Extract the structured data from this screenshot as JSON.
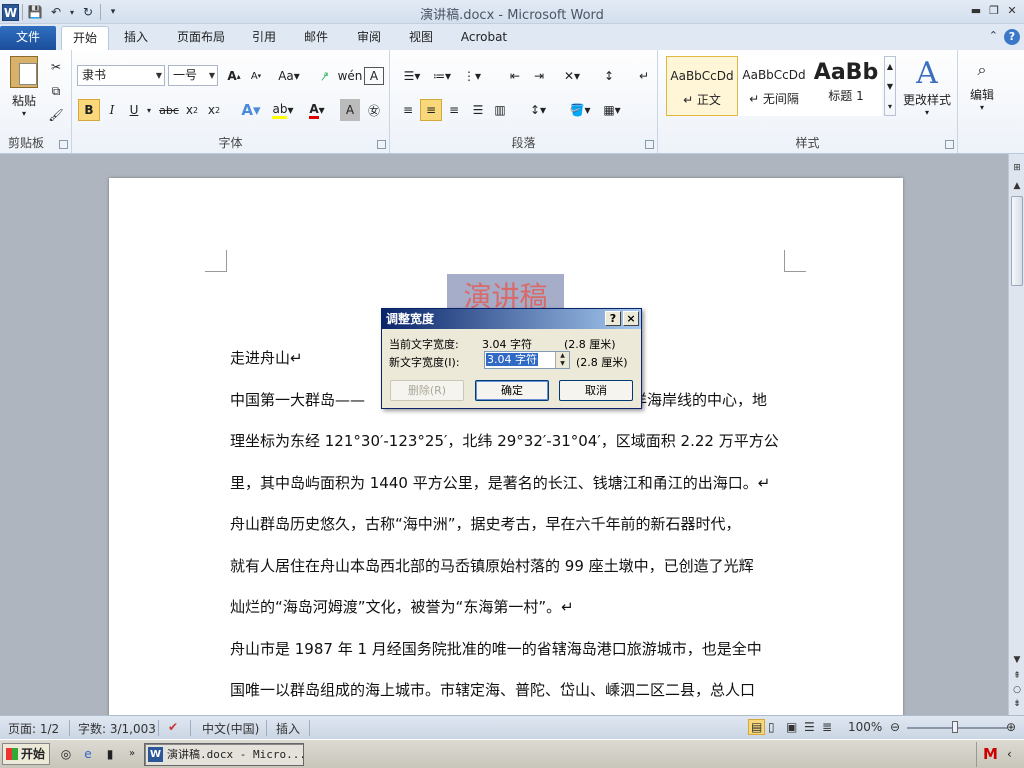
{
  "window": {
    "title": "演讲稿.docx - Microsoft Word"
  },
  "tabs": [
    {
      "label": "文件"
    },
    {
      "label": "开始"
    },
    {
      "label": "插入"
    },
    {
      "label": "页面布局"
    },
    {
      "label": "引用"
    },
    {
      "label": "邮件"
    },
    {
      "label": "审阅"
    },
    {
      "label": "视图"
    },
    {
      "label": "Acrobat"
    }
  ],
  "ribbon": {
    "clipboard": {
      "label": "剪贴板",
      "paste": "粘贴"
    },
    "font": {
      "label": "字体",
      "font_name": "隶书",
      "font_size": "一号"
    },
    "paragraph": {
      "label": "段落"
    },
    "styles": {
      "label": "样式",
      "items": [
        {
          "sample": "AaBbCcDd",
          "name": "↵ 正文"
        },
        {
          "sample": "AaBbCcDd",
          "name": "↵ 无间隔"
        },
        {
          "sample": "AaBb",
          "name": "标题 1"
        }
      ],
      "change_styles": "更改样式"
    },
    "editing": {
      "label": "编辑"
    }
  },
  "document": {
    "title_text": "演讲稿",
    "paragraphs": [
      "走进舟山↵",
      "中国第一大群岛——舟山群岛，位于我国东部黄金海岸线与长江黄金水道交汇处，是中国大陆海岸线的中心，地",
      "理坐标为东经 121°30′-123°25′，北纬 29°32′-31°04′，区域面积 2.22 万平方公",
      "里，其中岛屿面积为 1440 平方公里，是著名的长江、钱塘江和甬江的出海口。↵",
      "舟山群岛历史悠久，古称“海中洲”，据史考古，早在六千年前的新石器时代，",
      "就有人居住在舟山本岛西北部的马岙镇原始村落的 99 座土墩中，已创造了光辉",
      "灿烂的“海岛河姆渡”文化，被誉为“东海第一村”。↵",
      "舟山市是 1987 年 1 月经国务院批准的唯一的省辖海岛港口旅游城市，也是全中",
      "国唯一以群岛组成的海上城市。市辖定海、普陀、岱山、嵊泗二区二县，总人口"
    ],
    "para2_visible_head": "中国第一大群岛——",
    "para2_visible_tail": "洋海岸线的中心，地"
  },
  "dialog": {
    "title": "调整宽度",
    "help_btn": "?",
    "close_btn": "×",
    "current_label": "当前文字宽度:",
    "current_value": "3.04 字符",
    "current_cm": "(2.8 厘米)",
    "new_label": "新文字宽度(I):",
    "new_value": "3.04 字符",
    "new_cm": "(2.8 厘米)",
    "delete_btn": "删除(R)",
    "ok_btn": "确定",
    "cancel_btn": "取消"
  },
  "status": {
    "page": "页面: 1/2",
    "words": "字数: 3/1,003",
    "language": "中文(中国)",
    "mode": "插入",
    "zoom": "100%"
  },
  "taskbar": {
    "start": "开始",
    "task": "演讲稿.docx - Micro..."
  }
}
